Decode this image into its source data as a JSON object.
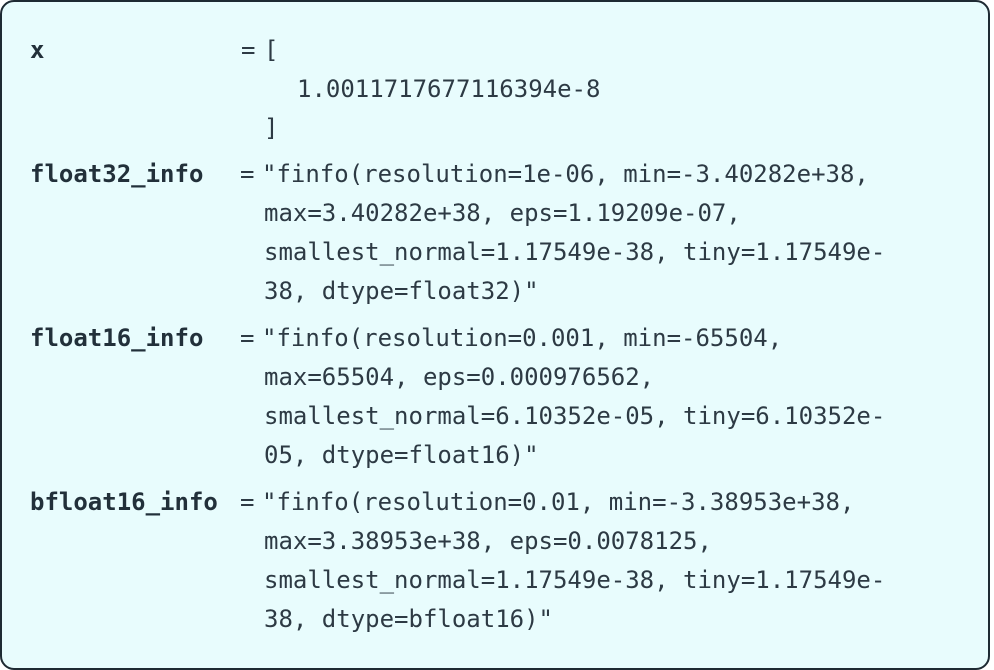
{
  "variables": [
    {
      "name": "x",
      "equals": "=",
      "lines": [
        "[",
        "1.0011717677116394e-8",
        "]"
      ]
    },
    {
      "name": "float32_info",
      "equals": "=",
      "lines": [
        "\"finfo(resolution=1e-06, min=-3.40282e+38,",
        "max=3.40282e+38, eps=1.19209e-07,",
        "smallest_normal=1.17549e-38, tiny=1.17549e-",
        "38, dtype=float32)\""
      ]
    },
    {
      "name": "float16_info",
      "equals": "=",
      "lines": [
        "\"finfo(resolution=0.001, min=-65504,",
        "max=65504, eps=0.000976562,",
        "smallest_normal=6.10352e-05, tiny=6.10352e-",
        "05, dtype=float16)\""
      ]
    },
    {
      "name": "bfloat16_info",
      "equals": "=",
      "lines": [
        "\"finfo(resolution=0.01, min=-3.38953e+38,",
        "max=3.38953e+38, eps=0.0078125,",
        "smallest_normal=1.17549e-38, tiny=1.17549e-",
        "38, dtype=bfloat16)\""
      ]
    }
  ]
}
